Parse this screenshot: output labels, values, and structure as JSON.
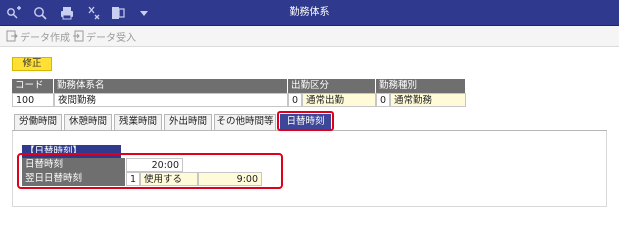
{
  "window": {
    "title": "勤務体系",
    "title_bar_icons": [
      "key-plus-icon",
      "search-icon",
      "printer-icon",
      "transfer-icon",
      "export-icon",
      "dropdown-arrow-icon"
    ]
  },
  "toolbar": {
    "data_create_label": "データ作成",
    "data_receive_label": "データ受入"
  },
  "mode_badge": "修正",
  "header_table": {
    "columns": {
      "code": "コード",
      "name": "勤務体系名",
      "attendance_category": "出勤区分",
      "work_type": "勤務種別"
    },
    "row": {
      "code": "100",
      "name": "夜間勤務",
      "attendance_code": "0",
      "attendance_label": "通常出勤",
      "work_type_code": "0",
      "work_type_label": "通常勤務"
    }
  },
  "tabs": [
    {
      "label": "労働時間",
      "active": false
    },
    {
      "label": "休憩時間",
      "active": false
    },
    {
      "label": "残業時間",
      "active": false
    },
    {
      "label": "外出時間",
      "active": false
    },
    {
      "label": "その他時間等",
      "active": false
    },
    {
      "label": "日替時刻",
      "active": true
    }
  ],
  "day_change": {
    "section_title": "【日替時刻】",
    "day_change_time_label": "日替時刻",
    "day_change_time_value": "20:00",
    "next_day_label": "翌日日替時刻",
    "next_day_code": "1",
    "next_day_option": "使用する",
    "next_day_time": "9:00"
  },
  "colors": {
    "title_bar": "#2f3a8f",
    "active_tab": "#3d4799",
    "mode_badge": "#ffe033",
    "highlight": "#e0001b",
    "input_yellow": "#fffbd9",
    "header_gray": "#6f6f6f"
  }
}
